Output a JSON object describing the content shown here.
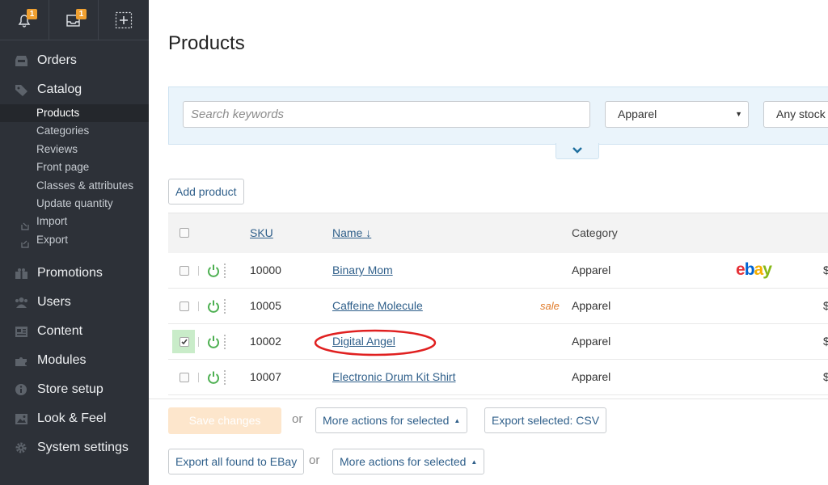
{
  "topbar": {
    "notifications_badge": "1",
    "messages_badge": "1"
  },
  "sidebar": {
    "sections": [
      {
        "label": "Orders",
        "icon": "orders-icon"
      },
      {
        "label": "Catalog",
        "icon": "catalog-tag-icon"
      }
    ],
    "catalog_items": [
      {
        "label": "Products"
      },
      {
        "label": "Categories"
      },
      {
        "label": "Reviews"
      },
      {
        "label": "Front page"
      },
      {
        "label": "Classes & attributes"
      },
      {
        "label": "Update quantity"
      },
      {
        "label": "Import"
      },
      {
        "label": "Export"
      }
    ],
    "other_sections": [
      {
        "label": "Promotions",
        "icon": "gift-icon"
      },
      {
        "label": "Users",
        "icon": "users-icon"
      },
      {
        "label": "Content",
        "icon": "content-icon"
      },
      {
        "label": "Modules",
        "icon": "puzzle-icon"
      },
      {
        "label": "Store setup",
        "icon": "info-icon"
      },
      {
        "label": "Look & Feel",
        "icon": "image-icon"
      },
      {
        "label": "System settings",
        "icon": "gear-icon"
      }
    ]
  },
  "page": {
    "title": "Products"
  },
  "search": {
    "placeholder": "Search keywords",
    "category": "Apparel",
    "stock": "Any stock s"
  },
  "actions": {
    "add_product": "Add product"
  },
  "table": {
    "headers": {
      "sku": "SKU",
      "name": "Name ↓",
      "category": "Category"
    },
    "rows": [
      {
        "sku": "10000",
        "name": "Binary Mom",
        "sale": "",
        "category": "Apparel",
        "ebay": "ebay",
        "price": "$",
        "checked": false
      },
      {
        "sku": "10005",
        "name": "Caffeine Molecule",
        "sale": "sale",
        "category": "Apparel",
        "ebay": "",
        "price": "$",
        "checked": false
      },
      {
        "sku": "10002",
        "name": "Digital Angel",
        "sale": "",
        "category": "Apparel",
        "ebay": "",
        "price": "$",
        "checked": true
      },
      {
        "sku": "10007",
        "name": "Electronic Drum Kit Shirt",
        "sale": "",
        "category": "Apparel",
        "ebay": "",
        "price": "$",
        "checked": false
      }
    ]
  },
  "bottom": {
    "save_changes": "Save changes",
    "or1": "or",
    "more_actions_1": "More actions for selected",
    "export_csv": "Export selected: CSV",
    "export_ebay": "Export all found to EBay",
    "or2": "or",
    "more_actions_2": "More actions for selected"
  },
  "colors": {
    "sidebar_bg": "#2d3138",
    "accent_link": "#2f5f8a",
    "power_green": "#4caf50",
    "sale_orange": "#e07b2a",
    "highlight_circle": "#e02020"
  }
}
